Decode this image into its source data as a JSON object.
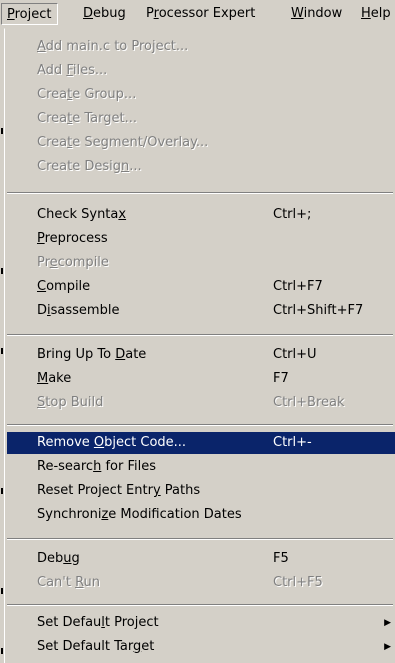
{
  "menubar": {
    "items": [
      {
        "pre": "",
        "ul": "P",
        "post": "roject"
      },
      {
        "pre": "",
        "ul": "D",
        "post": "ebug"
      },
      {
        "pre": "P",
        "ul": "r",
        "post": "ocessor Expert"
      },
      {
        "pre": "",
        "ul": "W",
        "post": "indow"
      },
      {
        "pre": "",
        "ul": "H",
        "post": "elp"
      }
    ]
  },
  "project_menu": {
    "add_main": {
      "pre": "",
      "ul": "A",
      "post": "dd main.c to Project..."
    },
    "add_files": {
      "pre": "Add ",
      "ul": "F",
      "post": "iles..."
    },
    "create_group": {
      "pre": "Crea",
      "ul": "t",
      "post": "e Group..."
    },
    "create_target": {
      "pre": "Crea",
      "ul": "t",
      "post": "e Target..."
    },
    "create_segment": {
      "pre": "Crea",
      "ul": "t",
      "post": "e Segment/Overlay..."
    },
    "create_design": {
      "pre": "Create Desig",
      "ul": "n",
      "post": "..."
    },
    "check_syntax": {
      "pre": "Check Synta",
      "ul": "x",
      "post": "",
      "shortcut": "Ctrl+;"
    },
    "preprocess": {
      "pre": "",
      "ul": "P",
      "post": "reprocess"
    },
    "precompile": {
      "pre": "Pr",
      "ul": "e",
      "post": "compile"
    },
    "compile": {
      "pre": "",
      "ul": "C",
      "post": "ompile",
      "shortcut": "Ctrl+F7"
    },
    "disassemble": {
      "pre": "D",
      "ul": "i",
      "post": "sassemble",
      "shortcut": "Ctrl+Shift+F7"
    },
    "bring_up_to_date": {
      "pre": "Bring Up To ",
      "ul": "D",
      "post": "ate",
      "shortcut": "Ctrl+U"
    },
    "make": {
      "pre": "",
      "ul": "M",
      "post": "ake",
      "shortcut": "F7"
    },
    "stop_build": {
      "pre": "",
      "ul": "S",
      "post": "top Build",
      "shortcut": "Ctrl+Break"
    },
    "remove_object_code": {
      "pre": "Remove ",
      "ul": "O",
      "post": "bject Code...",
      "shortcut": "Ctrl+-"
    },
    "research_files": {
      "pre": "Re-searc",
      "ul": "h",
      "post": " for Files"
    },
    "reset_paths": {
      "pre": "Reset Project Entr",
      "ul": "y",
      "post": " Paths"
    },
    "sync_dates": {
      "pre": "Synchroni",
      "ul": "z",
      "post": "e Modification Dates"
    },
    "debug": {
      "pre": "Deb",
      "ul": "u",
      "post": "g",
      "shortcut": "F5"
    },
    "cant_run": {
      "pre": "Can't ",
      "ul": "R",
      "post": "un",
      "shortcut": "Ctrl+F5"
    },
    "set_default_project": {
      "pre": "Set Defau",
      "ul": "l",
      "post": "t Project"
    },
    "set_default_target": {
      "pre": "Set Default Tar",
      "ul": "g",
      "post": "et"
    }
  },
  "colors": {
    "menu_bg": "#d4d0c8",
    "highlight_bg": "#0a246a",
    "disabled_text": "#808080"
  }
}
